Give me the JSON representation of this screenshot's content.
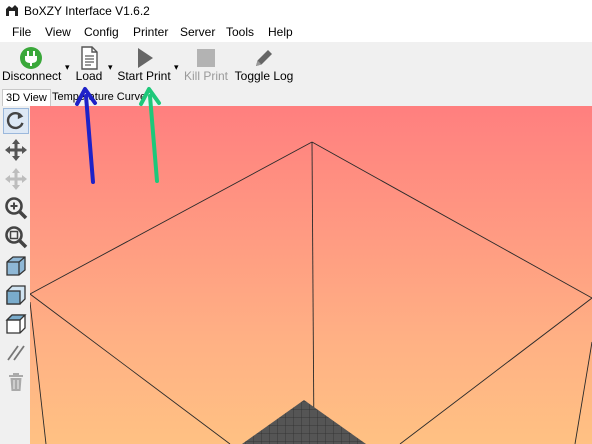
{
  "window": {
    "title": "BoXZY Interface V1.6.2"
  },
  "menu": [
    "File",
    "View",
    "Config",
    "Printer",
    "Server",
    "Tools",
    "Help"
  ],
  "toolbar": {
    "disconnect_label": "Disconnect",
    "load_label": "Load",
    "start_print_label": "Start Print",
    "kill_print_label": "Kill Print",
    "toggle_log_label": "Toggle Log",
    "dropdown_arrow": "▾"
  },
  "tabs": {
    "view_3d": "3D View",
    "temperature_curve": "Temperature Curve",
    "active": "3D View"
  },
  "sidebar": {
    "tools": [
      "reset-view-icon",
      "move-icon",
      "move-disabled-icon",
      "zoom-in-icon",
      "zoom-fit-icon",
      "iso-view-icon",
      "front-view-icon",
      "top-view-icon",
      "parallel-lines-icon",
      "trash-icon"
    ]
  },
  "viewport": {
    "gradient_top": "#ff7f7f",
    "gradient_bottom": "#ffc183",
    "bed_color": "#555555"
  },
  "annotations": [
    {
      "target": "Load",
      "color": "#1e22c8"
    },
    {
      "target": "Start Print",
      "color": "#1ec87a"
    }
  ]
}
